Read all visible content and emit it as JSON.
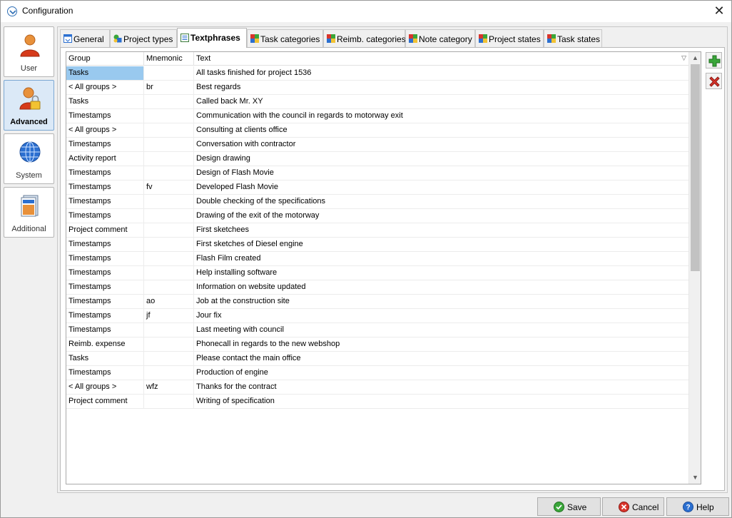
{
  "window": {
    "title": "Configuration"
  },
  "nav": {
    "items": [
      {
        "label": "User",
        "icon": "user-icon",
        "active": false
      },
      {
        "label": "Advanced",
        "icon": "user-lock-icon",
        "active": true
      },
      {
        "label": "System",
        "icon": "globe-icon",
        "active": false
      },
      {
        "label": "Additional",
        "icon": "document-stack-icon",
        "active": false
      }
    ]
  },
  "tabs": [
    {
      "label": "General",
      "icon": "window-icon",
      "active": false
    },
    {
      "label": "Project types",
      "icon": "shapes-icon",
      "active": false
    },
    {
      "label": "Textphrases",
      "icon": "text-list-icon",
      "active": true
    },
    {
      "label": "Task categories",
      "icon": "color-grid-icon",
      "active": false
    },
    {
      "label": "Reimb. categories",
      "icon": "color-grid-icon",
      "active": false
    },
    {
      "label": "Note category",
      "icon": "color-grid-icon",
      "active": false
    },
    {
      "label": "Project states",
      "icon": "color-grid-icon",
      "active": false
    },
    {
      "label": "Task states",
      "icon": "color-grid-icon",
      "active": false
    }
  ],
  "grid": {
    "columns": [
      "Group",
      "Mnemonic",
      "Text"
    ],
    "sort_indicator": "▽",
    "rows": [
      {
        "group": "Tasks",
        "mnemonic": "",
        "text": "All tasks finished for project 1536"
      },
      {
        "group": "< All groups >",
        "mnemonic": "br",
        "text": "Best regards"
      },
      {
        "group": "Tasks",
        "mnemonic": "",
        "text": "Called back Mr. XY"
      },
      {
        "group": "Timestamps",
        "mnemonic": "",
        "text": "Communication with the council in regards to motorway exit"
      },
      {
        "group": "< All groups >",
        "mnemonic": "",
        "text": "Consulting at clients office"
      },
      {
        "group": "Timestamps",
        "mnemonic": "",
        "text": "Conversation with contractor"
      },
      {
        "group": "Activity report",
        "mnemonic": "",
        "text": "Design drawing"
      },
      {
        "group": "Timestamps",
        "mnemonic": "",
        "text": "Design of Flash Movie"
      },
      {
        "group": "Timestamps",
        "mnemonic": "fv",
        "text": "Developed Flash Movie"
      },
      {
        "group": "Timestamps",
        "mnemonic": "",
        "text": "Double checking of the specifications"
      },
      {
        "group": "Timestamps",
        "mnemonic": "",
        "text": "Drawing of the exit of the motorway"
      },
      {
        "group": "Project comment",
        "mnemonic": "",
        "text": "First sketchees"
      },
      {
        "group": "Timestamps",
        "mnemonic": "",
        "text": "First sketches of Diesel engine"
      },
      {
        "group": "Timestamps",
        "mnemonic": "",
        "text": "Flash Film created"
      },
      {
        "group": "Timestamps",
        "mnemonic": "",
        "text": "Help installing software"
      },
      {
        "group": "Timestamps",
        "mnemonic": "",
        "text": "Information on website updated"
      },
      {
        "group": "Timestamps",
        "mnemonic": "ao",
        "text": "Job at the construction site"
      },
      {
        "group": "Timestamps",
        "mnemonic": "jf",
        "text": "Jour fix"
      },
      {
        "group": "Timestamps",
        "mnemonic": "",
        "text": "Last meeting with council"
      },
      {
        "group": "Reimb. expense",
        "mnemonic": "",
        "text": "Phonecall in regards to the new webshop"
      },
      {
        "group": "Tasks",
        "mnemonic": "",
        "text": "Please contact the main office"
      },
      {
        "group": "Timestamps",
        "mnemonic": "",
        "text": "Production of engine"
      },
      {
        "group": "< All groups >",
        "mnemonic": "wfz",
        "text": "Thanks for the contract"
      },
      {
        "group": "Project comment",
        "mnemonic": "",
        "text": "Writing of specification"
      }
    ]
  },
  "side_buttons": {
    "add": "add-icon",
    "delete": "delete-icon"
  },
  "footer": {
    "save": "Save",
    "cancel": "Cancel",
    "help": "Help"
  },
  "colors": {
    "selection": "#99c9ef",
    "active_nav": "#dbe9f7",
    "add_green": "#3aa63a",
    "delete_red": "#d9342b"
  }
}
